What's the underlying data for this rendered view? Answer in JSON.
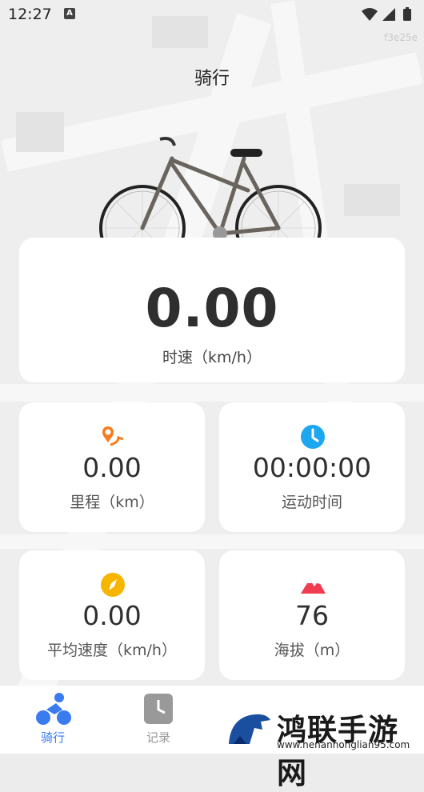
{
  "status_bar": {
    "time": "12:27",
    "a_indicator": "A"
  },
  "top_watermark": "f3e25e",
  "page": {
    "title": "骑行"
  },
  "speed": {
    "value": "0.00",
    "label": "时速（km/h）"
  },
  "stats": [
    {
      "icon": "location-route-icon",
      "value": "0.00",
      "label": "里程（km）",
      "color": "#f57c1f"
    },
    {
      "icon": "clock-icon",
      "value": "00:00:00",
      "label": "运动时间",
      "color": "#1ea7f1"
    },
    {
      "icon": "compass-icon",
      "value": "0.00",
      "label": "平均速度（km/h）",
      "color": "#f7b500"
    },
    {
      "icon": "mountain-icon",
      "value": "76",
      "label": "海拔（m）",
      "color": "#f03c50"
    }
  ],
  "tabs": [
    {
      "label": "骑行",
      "icon": "cycling-icon",
      "active": true
    },
    {
      "label": "记录",
      "icon": "record-icon",
      "active": false
    }
  ],
  "colors": {
    "accent": "#3a7bf0",
    "inactive": "#999999"
  },
  "brand_watermark": {
    "name": "鸿联手游网",
    "url": "www.henanhonglian95.com"
  }
}
